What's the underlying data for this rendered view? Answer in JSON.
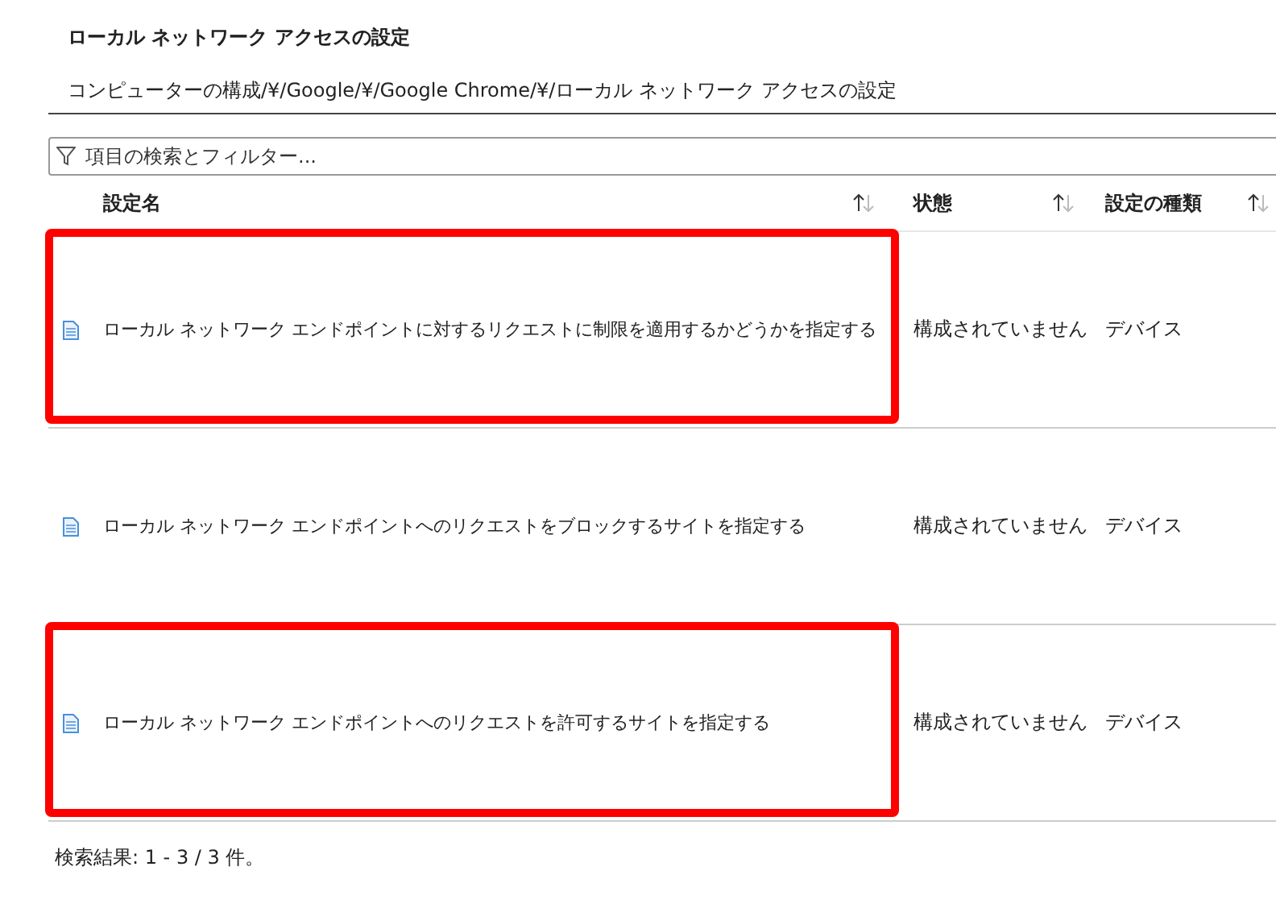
{
  "title": "ローカル ネットワーク アクセスの設定",
  "breadcrumb": "コンピューターの構成/¥/Google/¥/Google Chrome/¥/ローカル ネットワーク アクセスの設定",
  "search": {
    "placeholder": "項目の検索とフィルター..."
  },
  "columns": [
    "設定名",
    "状態",
    "設定の種類"
  ],
  "rows": [
    {
      "name": "ローカル ネットワーク エンドポイントに対するリクエストに制限を適用するかどうかを指定する",
      "state": "構成されていません",
      "type": "デバイス",
      "highlighted": true
    },
    {
      "name": "ローカル ネットワーク エンドポイントへのリクエストをブロックするサイトを指定する",
      "state": "構成されていません",
      "type": "デバイス",
      "highlighted": false
    },
    {
      "name": "ローカル ネットワーク エンドポイントへのリクエストを許可するサイトを指定する",
      "state": "構成されていません",
      "type": "デバイス",
      "highlighted": true
    }
  ],
  "footer": "検索結果: 1 - 3 / 3 件。"
}
